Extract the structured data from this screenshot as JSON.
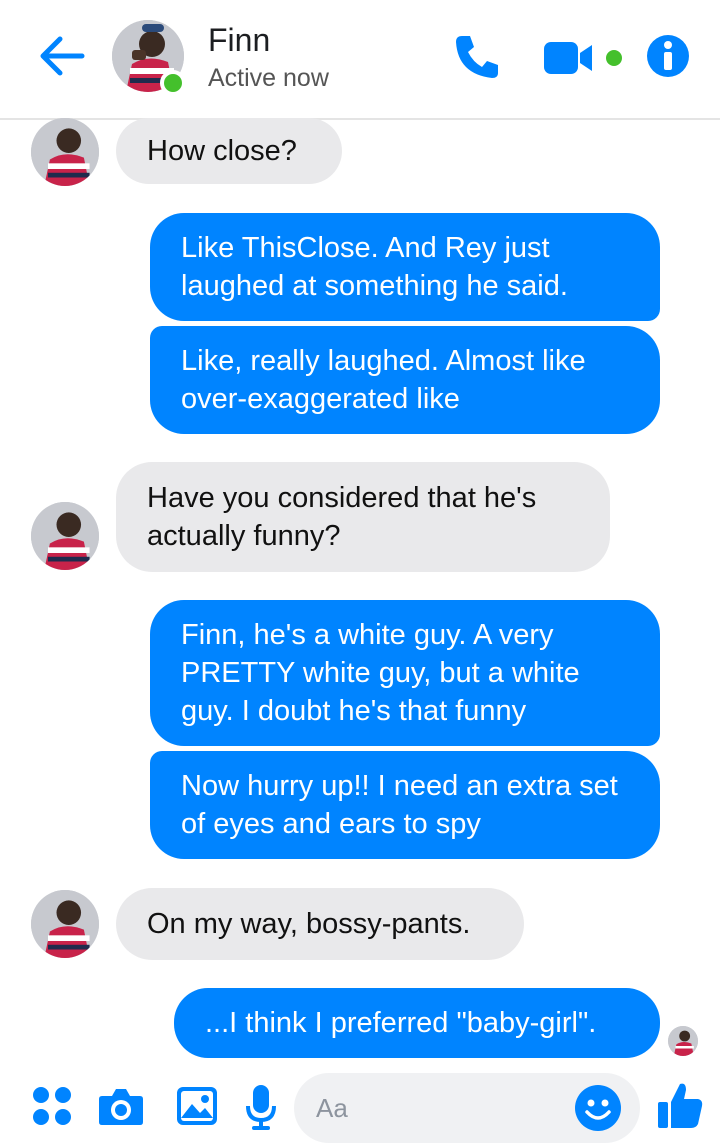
{
  "header": {
    "contact_name": "Finn",
    "status": "Active now"
  },
  "messages": [
    {
      "from": "contact",
      "text": "How close?"
    },
    {
      "from": "me",
      "text": "Like ThisClose. And Rey just laughed at something he said."
    },
    {
      "from": "me",
      "text": "Like, really laughed. Almost like over-exaggerated like"
    },
    {
      "from": "contact",
      "text": "Have you considered that he's actually funny?"
    },
    {
      "from": "me",
      "text": "Finn, he's a white guy. A very PRETTY white guy, but a white guy. I doubt he's that funny"
    },
    {
      "from": "me",
      "text": "Now hurry up!! I need an extra set of eyes and ears to spy"
    },
    {
      "from": "contact",
      "text": "On my way, bossy-pants."
    },
    {
      "from": "me",
      "text": "...I think I preferred \"baby-girl\"."
    }
  ],
  "composer": {
    "placeholder": "Aa"
  },
  "colors": {
    "accent": "#0084ff",
    "incoming_bubble": "#e9e9eb",
    "online": "#44c02c"
  },
  "icons": [
    "back-arrow-icon",
    "phone-icon",
    "video-camera-icon",
    "info-icon",
    "apps-grid-icon",
    "camera-icon",
    "gallery-icon",
    "microphone-icon",
    "emoji-icon",
    "thumbs-up-icon"
  ]
}
